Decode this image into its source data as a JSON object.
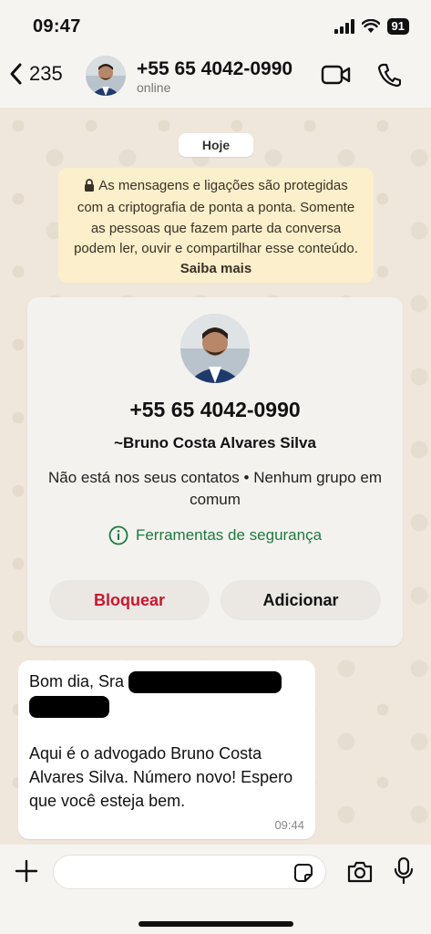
{
  "status_bar": {
    "time": "09:47",
    "battery": "91"
  },
  "header": {
    "back_count": "235",
    "title": "+55 65 4042-0990",
    "subtitle": "online"
  },
  "chat": {
    "day_label": "Hoje",
    "encryption_notice": "As mensagens e ligações são protegidas com a criptografia de ponta a ponta. Somente as pessoas que fazem parte da conversa podem ler, ouvir e compartilhar esse conteúdo.",
    "encryption_link": "Saiba mais",
    "contact_card": {
      "phone": "+55 65 4042-0990",
      "name": "~Bruno Costa Alvares Silva",
      "info": "Não está nos seus contatos • Nenhum grupo em comum",
      "security_tools": "Ferramentas de segurança",
      "block_label": "Bloquear",
      "add_label": "Adicionar"
    },
    "message": {
      "greeting": "Bom dia, Sra",
      "body": "Aqui é o advogado Bruno Costa Alvares Silva. Número novo! Espero que você esteja bem.",
      "time": "09:44"
    }
  },
  "colors": {
    "block_red": "#d0142c",
    "security_green": "#1c7a43",
    "notice_bg": "#fcefcb"
  },
  "icons": [
    "chevron-left-icon",
    "video-call-icon",
    "phone-call-icon",
    "lock-icon",
    "info-icon",
    "plus-icon",
    "sticker-icon",
    "camera-icon",
    "microphone-icon"
  ]
}
